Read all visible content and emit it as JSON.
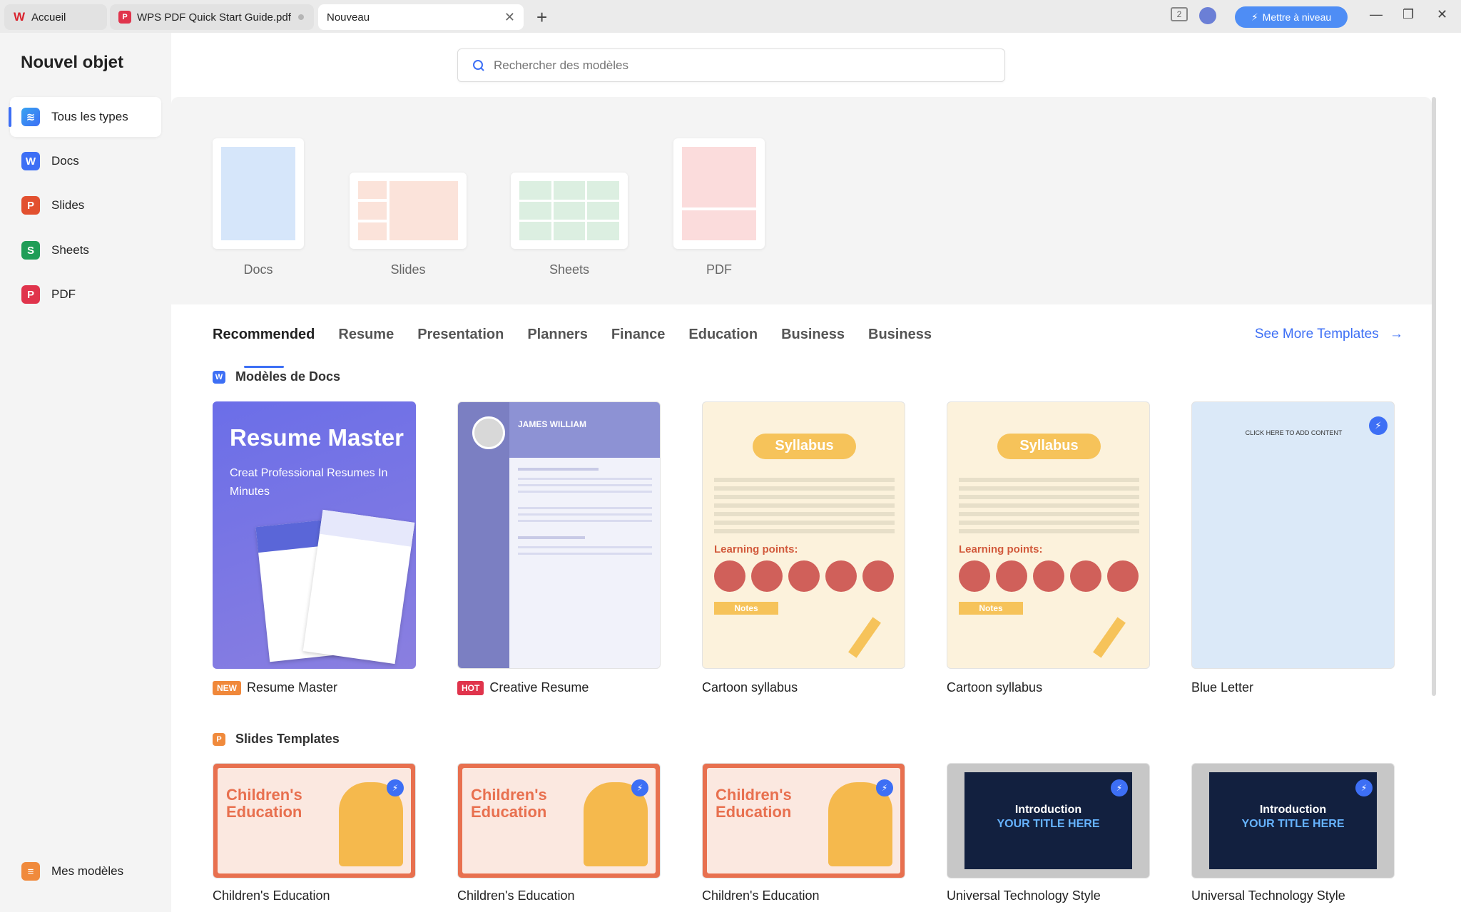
{
  "tabs": [
    {
      "label": "Accueil",
      "icon": "wps-logo-icon"
    },
    {
      "label": "WPS PDF Quick Start Guide.pdf",
      "icon": "pdf-icon"
    },
    {
      "label": "Nouveau"
    }
  ],
  "toolbar": {
    "upgrade_label": "Mettre à niveau",
    "window_count": "2"
  },
  "sidebar": {
    "title": "Nouvel objet",
    "items": [
      {
        "label": "Tous les types",
        "icon": "layers-icon"
      },
      {
        "label": "Docs",
        "icon": "W"
      },
      {
        "label": "Slides",
        "icon": "P"
      },
      {
        "label": "Sheets",
        "icon": "S"
      },
      {
        "label": "PDF",
        "icon": "pdf-icon"
      }
    ],
    "templates_label": "Mes modèles"
  },
  "search": {
    "placeholder": "Rechercher des modèles"
  },
  "new_types": [
    {
      "label": "Docs"
    },
    {
      "label": "Slides"
    },
    {
      "label": "Sheets"
    },
    {
      "label": "PDF"
    }
  ],
  "category_tabs": [
    "Recommended",
    "Resume",
    "Presentation",
    "Planners",
    "Finance",
    "Education",
    "Business",
    "Business"
  ],
  "see_more": "See More Templates",
  "sections": {
    "docs": {
      "title": "Modèles de Docs",
      "cards": [
        {
          "label": "Resume Master",
          "badge": "NEW",
          "thumb_title": "Resume Master",
          "thumb_sub": "Creat Professional Resumes In Minutes"
        },
        {
          "label": "Creative Resume",
          "badge": "HOT",
          "thumb_title": "JAMES WILLIAM"
        },
        {
          "label": "Cartoon syllabus",
          "thumb_title": "Syllabus",
          "thumb_sub": "Learning points:",
          "thumb_notes": "Notes"
        },
        {
          "label": "Cartoon syllabus",
          "thumb_title": "Syllabus",
          "thumb_sub": "Learning points:",
          "thumb_notes": "Notes"
        },
        {
          "label": "Blue Letter",
          "thumb_title": "CLICK HERE TO ADD CONTENT"
        }
      ]
    },
    "slides": {
      "title": "Slides Templates",
      "cards": [
        {
          "label": "Children's Education",
          "thumb_title": "Children's Education"
        },
        {
          "label": "Children's Education",
          "thumb_title": "Children's Education"
        },
        {
          "label": "Children's Education",
          "thumb_title": "Children's Education"
        },
        {
          "label": "Universal Technology Style",
          "thumb_title": "Introduction",
          "thumb_sub": "YOUR TITLE HERE"
        },
        {
          "label": "Universal Technology Style",
          "thumb_title": "Introduction",
          "thumb_sub": "YOUR TITLE HERE"
        }
      ]
    }
  },
  "colors": {
    "accent": "#3d6ff5",
    "docs": "#3d6ff5",
    "slides": "#e2502f",
    "sheets": "#1f9d57",
    "pdf": "#e0344c",
    "upgrade": "#4e8df5"
  }
}
